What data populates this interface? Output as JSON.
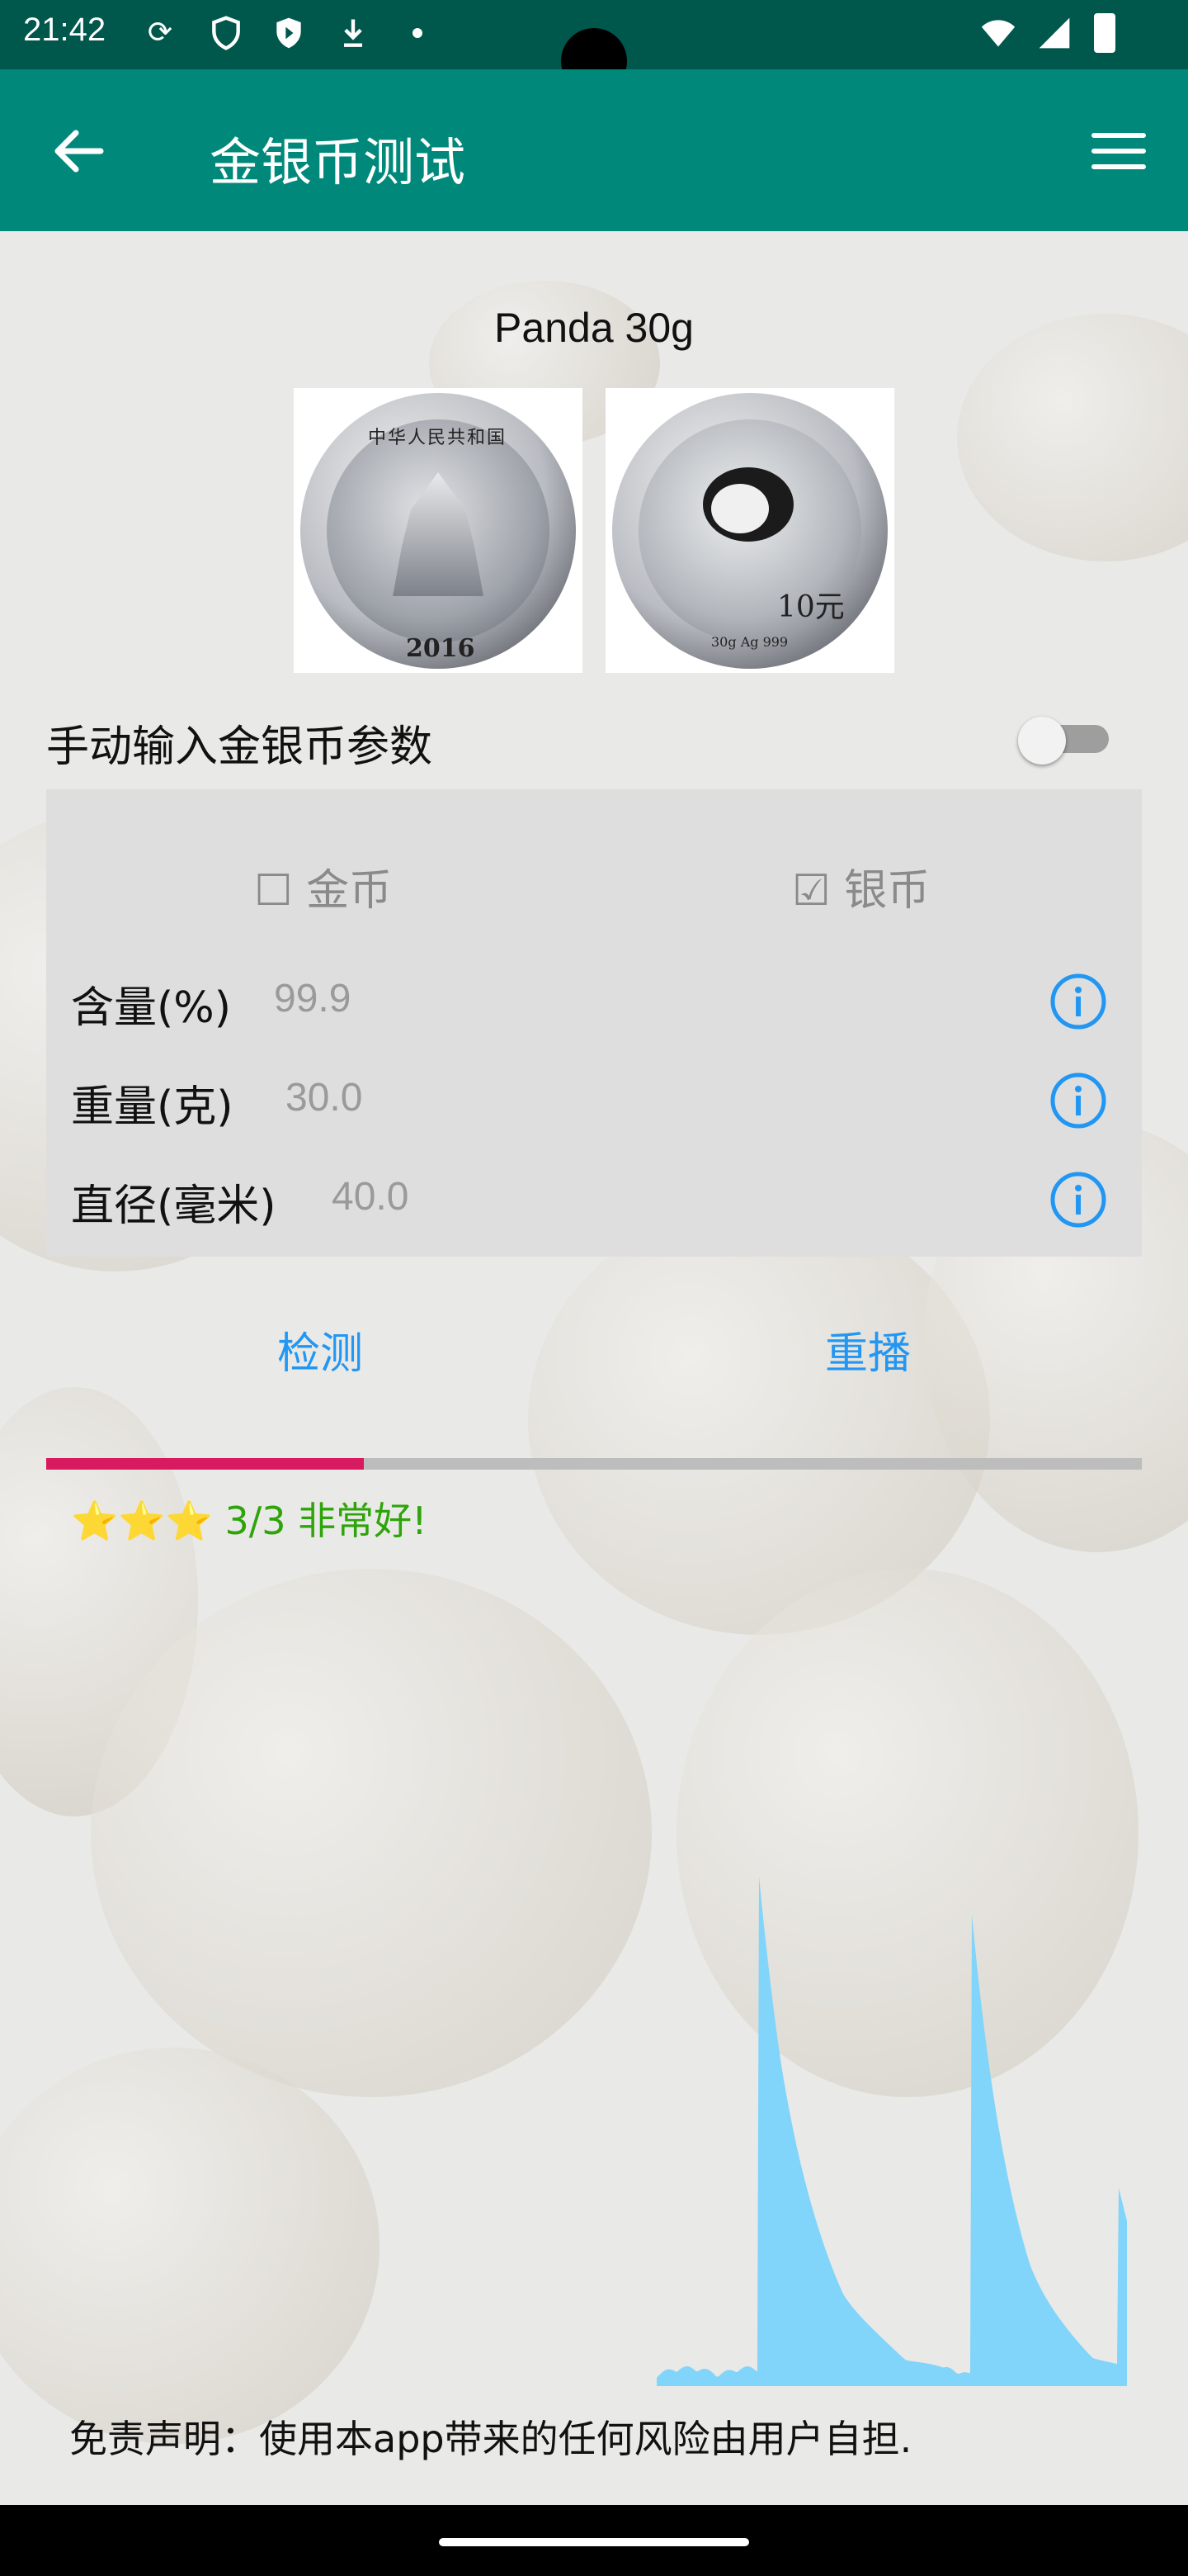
{
  "status_bar": {
    "time": "21:42"
  },
  "toolbar": {
    "title": "金银币测试"
  },
  "coin": {
    "name": "Panda 30g",
    "obverse_year": "2016",
    "reverse_denomination": "10元",
    "reverse_inscription": "30g Ag 999",
    "obverse_inscription": "中华人民共和国"
  },
  "manual_input": {
    "label": "手动输入金银币参数",
    "enabled": false
  },
  "params": {
    "gold_label": "金币",
    "gold_checked": false,
    "silver_label": "银币",
    "silver_checked": true,
    "rows": [
      {
        "label": "含量(%)",
        "value": "99.9"
      },
      {
        "label": "重量(克)",
        "value": "30.0"
      },
      {
        "label": "直径(毫米)",
        "value": "40.0"
      }
    ]
  },
  "actions": {
    "detect": "检测",
    "replay": "重播"
  },
  "progress": {
    "fraction": 0.29,
    "color": "#d81b60"
  },
  "result": {
    "stars": "⭐⭐⭐",
    "text": "3/3 非常好!",
    "color": "#2ea40a"
  },
  "spectrum_color": "#81d4fa",
  "disclaimer": "免责声明：使用本app带来的任何风险由用户自担."
}
